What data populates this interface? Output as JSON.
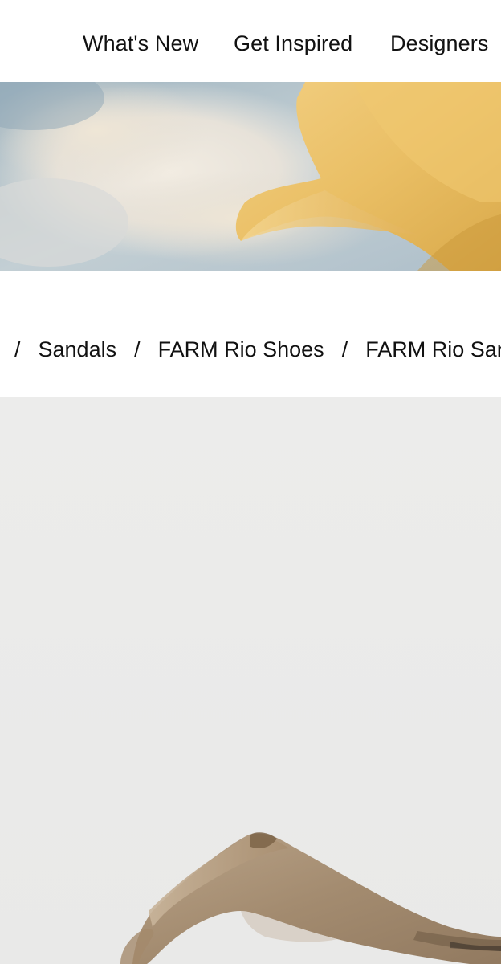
{
  "nav": {
    "items": [
      {
        "label": "What's New"
      },
      {
        "label": "Get Inspired"
      },
      {
        "label": "Designers"
      }
    ]
  },
  "hero": {
    "image": "sky-with-yellow-fabric-banner"
  },
  "breadcrumb": {
    "separator": "/",
    "items": [
      {
        "label": "Sandals"
      },
      {
        "label": "FARM Rio Shoes"
      },
      {
        "label": "FARM Rio Sandals"
      }
    ]
  },
  "product": {
    "image": "translucent-tan-thong-sandal",
    "colors": {
      "background": "#ebebea",
      "sandal": "#a48a6c"
    }
  },
  "colors": {
    "hero_sky": "#b9c7cf",
    "hero_fabric": "#edc878",
    "text": "#111111"
  }
}
